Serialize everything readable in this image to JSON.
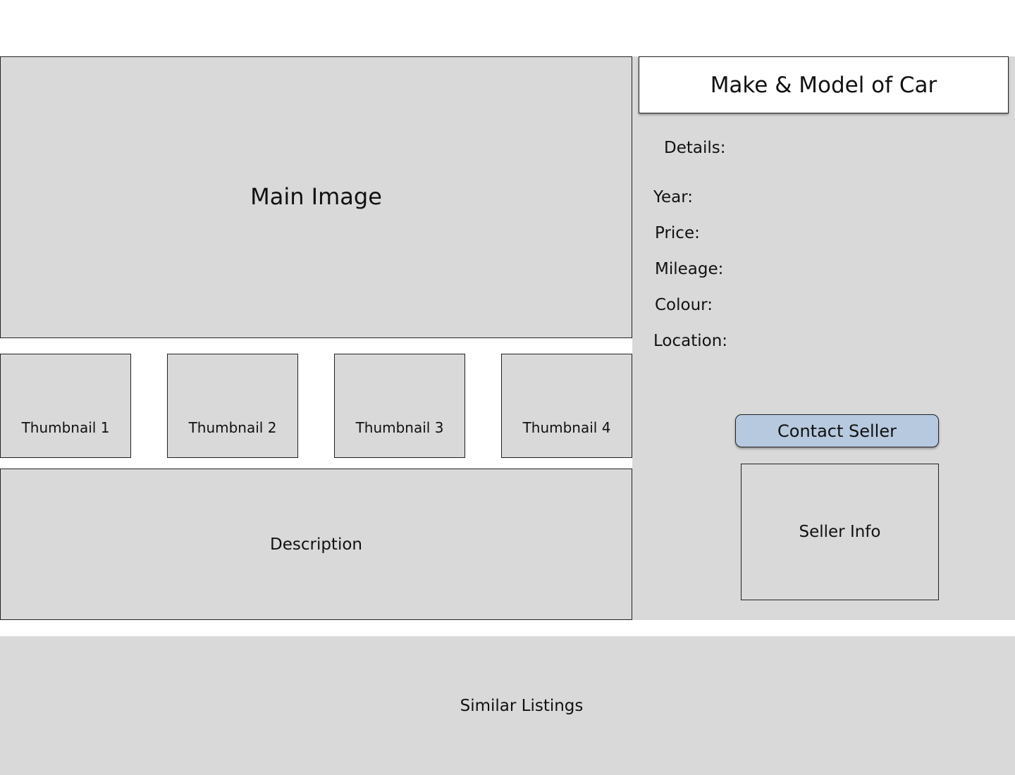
{
  "gallery": {
    "main_image_label": "Main Image",
    "thumbnails": [
      {
        "label": "Thumbnail 1"
      },
      {
        "label": "Thumbnail 2"
      },
      {
        "label": "Thumbnail 3"
      },
      {
        "label": "Thumbnail 4"
      }
    ]
  },
  "description": {
    "label": "Description"
  },
  "listing": {
    "title": "Make & Model of Car",
    "details_heading": "Details:",
    "details": {
      "year_label": "Year:",
      "price_label": "Price:",
      "mileage_label": "Mileage:",
      "colour_label": "Colour:",
      "location_label": "Location:"
    },
    "contact_button_label": "Contact Seller",
    "seller_info_label": "Seller Info"
  },
  "similar_listings": {
    "label": "Similar Listings"
  },
  "colors": {
    "placeholder_gray": "#d9d9d9",
    "button_blue": "#b7c9df",
    "border": "#222222",
    "background": "#ffffff"
  }
}
